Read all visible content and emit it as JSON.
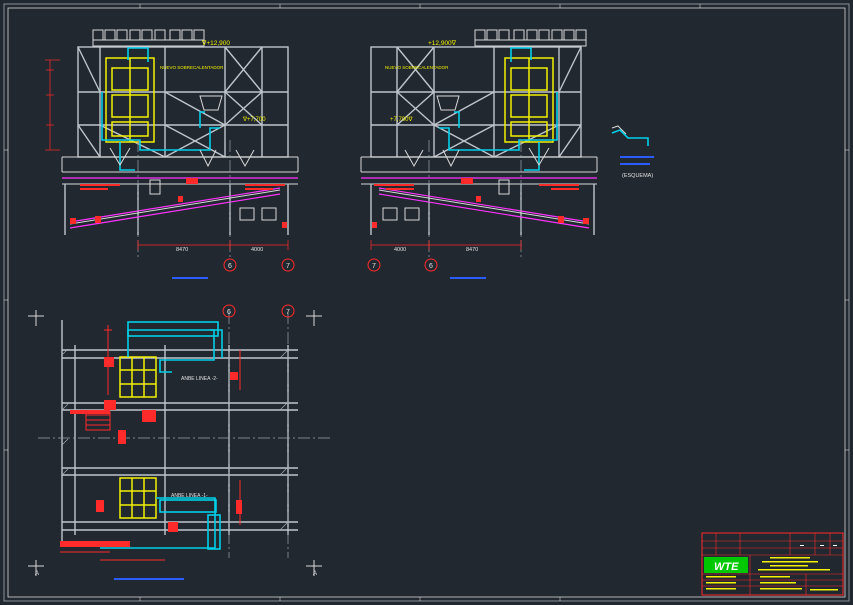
{
  "drawing": {
    "elevation_labels": {
      "top_left": "∇+12,900",
      "top_right": "+12,900∇",
      "mid_left": "∇+7,700",
      "mid_right": "+7,700∇"
    },
    "notes": {
      "overheater_left": "NUEVO SOBRECALENTADOR",
      "overheater_right": "NUEVO SOBRECALENTADOR",
      "plan_line_upper": "ANBE LINEA -2-",
      "plan_line_lower": "ANBE LINEA -1-",
      "isometric": "(ESQUEMA)"
    },
    "dimensions": {
      "left_a": "8470",
      "left_b": "4000",
      "right_a": "4000",
      "right_b": "8470"
    },
    "grid_markers": {
      "six": "6",
      "seven": "7"
    },
    "section_markers": {
      "a": "A"
    },
    "title_block": {
      "logo": "WTE",
      "colors": {
        "accent": "#00c800",
        "border": "#ff2a2a",
        "ink": "#f3f000"
      }
    },
    "colors": {
      "background": "#212830",
      "structure": "#d8d8d8",
      "piping": "#00cfe8",
      "equipment": "#f3f000",
      "annotation": "#ff2a2a",
      "conveyor": "#ff33ff"
    }
  }
}
